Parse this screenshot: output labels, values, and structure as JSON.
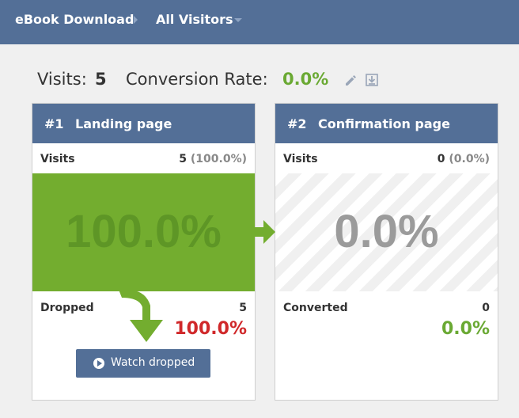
{
  "breadcrumb": {
    "item1": "eBook Download",
    "item2": "All Visitors"
  },
  "summary": {
    "visits_label": "Visits:",
    "visits_value": "5",
    "conversion_label": "Conversion Rate:",
    "conversion_value": "0.0%"
  },
  "steps": [
    {
      "number": "#1",
      "title": "Landing page",
      "visits_label": "Visits",
      "visits_count": "5",
      "visits_pct": "(100.0%)",
      "big_pct": "100.0%",
      "bottom_label": "Dropped",
      "bottom_count": "5",
      "bottom_pct": "100.0%",
      "button_label": "Watch dropped"
    },
    {
      "number": "#2",
      "title": "Confirmation page",
      "visits_label": "Visits",
      "visits_count": "0",
      "visits_pct": "(0.0%)",
      "big_pct": "0.0%",
      "bottom_label": "Converted",
      "bottom_count": "0",
      "bottom_pct": "0.0%"
    }
  ],
  "colors": {
    "header": "#536f97",
    "green": "#73ad2f",
    "dropped_red": "#d0282a",
    "converted_green": "#6aa933"
  },
  "icons": {
    "edit": "pencil-icon",
    "export": "download-icon",
    "play": "play-icon"
  }
}
